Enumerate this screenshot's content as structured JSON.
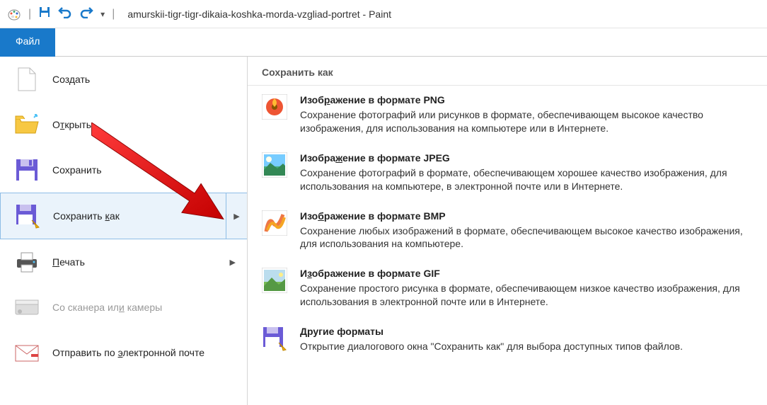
{
  "titlebar": {
    "title": "amurskii-tigr-tigr-dikaia-koshka-morda-vzgliad-portret - Paint"
  },
  "ribbon": {
    "file_tab": "Файл"
  },
  "file_menu": {
    "new": "Создать",
    "open_pre": "О",
    "open_key": "т",
    "open_post": "крыть",
    "save": "Сохранить",
    "save_as_pre": "Сохранить ",
    "save_as_key": "к",
    "save_as_post": "ак",
    "print_key": "П",
    "print_post": "ечать",
    "scanner_pre": "Со сканера ил",
    "scanner_key": "и",
    "scanner_post": " камеры",
    "email_pre": "Отправить по ",
    "email_key": "э",
    "email_post": "лектронной почте"
  },
  "submenu": {
    "header": "Сохранить как",
    "png": {
      "title_pre": "Изоб",
      "title_key": "р",
      "title_post": "ажение в формате PNG",
      "desc": "Сохранение фотографий или рисунков в формате, обеспечивающем высокое качество изображения, для использования на компьютере или в Интернете."
    },
    "jpeg": {
      "title_pre": "Изобра",
      "title_key": "ж",
      "title_post": "ение в формате JPEG",
      "desc": "Сохранение фотографий в формате, обеспечивающем хорошее качество изображения, для использования на компьютере, в электронной почте или в Интернете."
    },
    "bmp": {
      "title_pre": "Изо",
      "title_key": "б",
      "title_post": "ражение в формате BMP",
      "desc": "Сохранение любых изображений в формате, обеспечивающем высокое качество изображения, для использования на компьютере."
    },
    "gif": {
      "title_pre": "И",
      "title_key": "з",
      "title_post": "ображение в формате GIF",
      "desc": "Сохранение простого рисунка в формате, обеспечивающем низкое качество изображения, для использования в электронной почте или в Интернете."
    },
    "other": {
      "title": "Другие форматы",
      "desc": "Открытие диалогового окна \"Сохранить как\" для выбора доступных типов файлов."
    }
  }
}
